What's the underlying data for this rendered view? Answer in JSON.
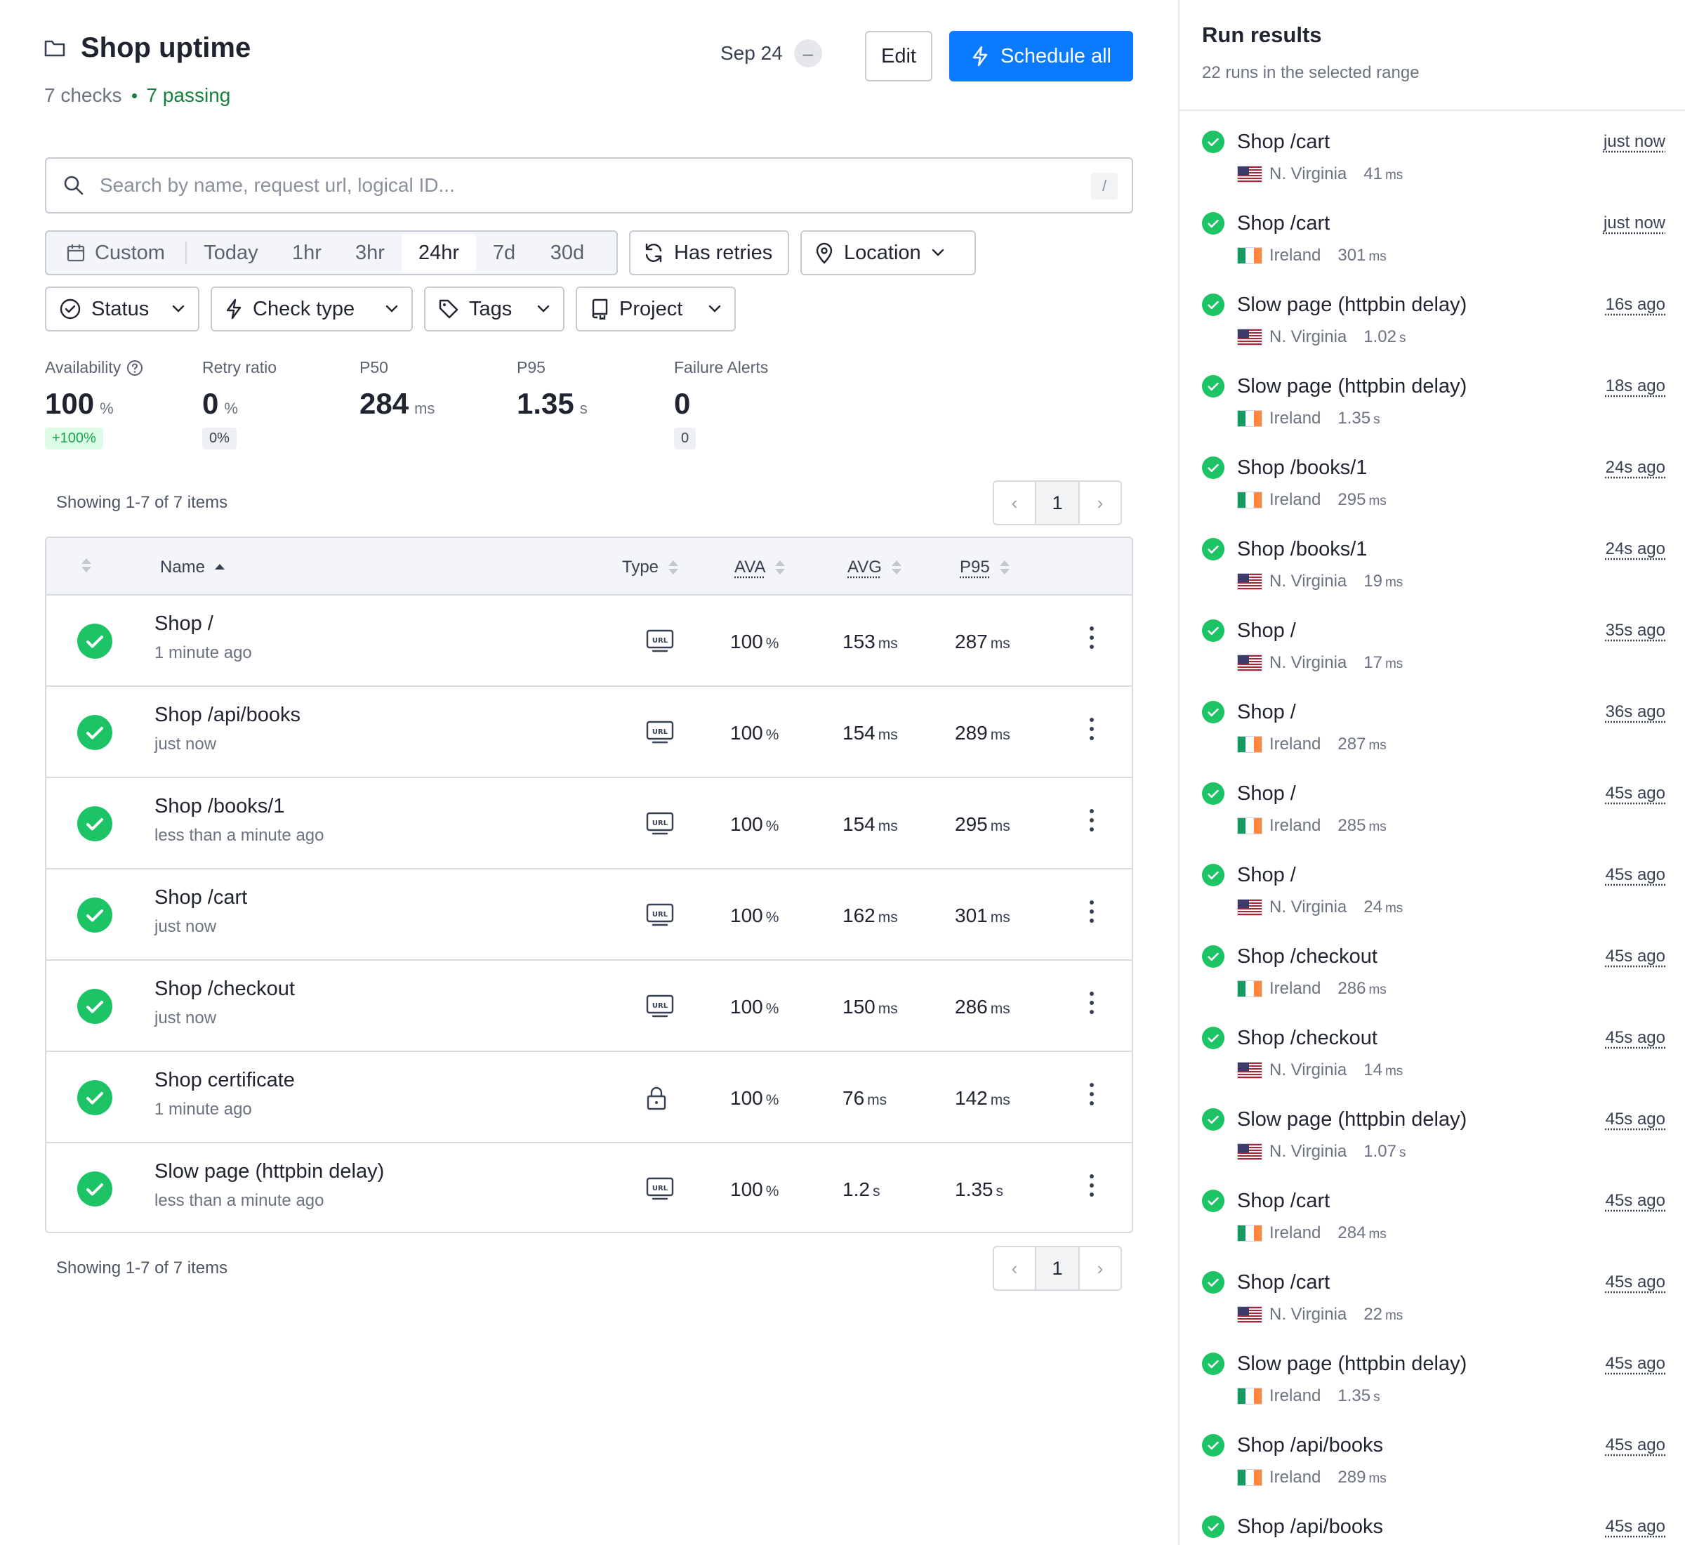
{
  "header": {
    "title": "Shop uptime",
    "checks_count": "7 checks",
    "passing": "7 passing",
    "date": "Sep 24",
    "date_clear": "–",
    "edit_label": "Edit",
    "schedule_label": "Schedule all"
  },
  "search": {
    "placeholder": "Search by name, request url, logical ID...",
    "shortcut": "/"
  },
  "filters": {
    "ranges": [
      "Custom",
      "Today",
      "1hr",
      "3hr",
      "24hr",
      "7d",
      "30d"
    ],
    "active_range": "24hr",
    "has_retries": "Has retries",
    "location": "Location",
    "status": "Status",
    "check_type": "Check type",
    "tags": "Tags",
    "project": "Project"
  },
  "stats": [
    {
      "label": "Availability",
      "value": "100",
      "unit": "%",
      "delta": "+100%"
    },
    {
      "label": "Retry ratio",
      "value": "0",
      "unit": "%",
      "delta": "0%"
    },
    {
      "label": "P50",
      "value": "284",
      "unit": "ms"
    },
    {
      "label": "P95",
      "value": "1.35",
      "unit": "s"
    },
    {
      "label": "Failure Alerts",
      "value": "0",
      "delta": "0"
    }
  ],
  "table": {
    "showing": "Showing 1-7 of 7 items",
    "page": "1",
    "columns": {
      "name": "Name",
      "type": "Type",
      "ava": "AVA",
      "avg": "AVG",
      "p95": "P95"
    },
    "rows": [
      {
        "name": "Shop /",
        "ago": "1 minute ago",
        "type": "url",
        "ava": "100",
        "ava_unit": "%",
        "avg": "153",
        "avg_unit": "ms",
        "p95": "287",
        "p95_unit": "ms"
      },
      {
        "name": "Shop /api/books",
        "ago": "just now",
        "type": "url",
        "ava": "100",
        "ava_unit": "%",
        "avg": "154",
        "avg_unit": "ms",
        "p95": "289",
        "p95_unit": "ms"
      },
      {
        "name": "Shop /books/1",
        "ago": "less than a minute ago",
        "type": "url",
        "ava": "100",
        "ava_unit": "%",
        "avg": "154",
        "avg_unit": "ms",
        "p95": "295",
        "p95_unit": "ms"
      },
      {
        "name": "Shop /cart",
        "ago": "just now",
        "type": "url",
        "ava": "100",
        "ava_unit": "%",
        "avg": "162",
        "avg_unit": "ms",
        "p95": "301",
        "p95_unit": "ms"
      },
      {
        "name": "Shop /checkout",
        "ago": "just now",
        "type": "url",
        "ava": "100",
        "ava_unit": "%",
        "avg": "150",
        "avg_unit": "ms",
        "p95": "286",
        "p95_unit": "ms"
      },
      {
        "name": "Shop certificate",
        "ago": "1 minute ago",
        "type": "lock",
        "ava": "100",
        "ava_unit": "%",
        "avg": "76",
        "avg_unit": "ms",
        "p95": "142",
        "p95_unit": "ms"
      },
      {
        "name": "Slow page (httpbin delay)",
        "ago": "less than a minute ago",
        "type": "url",
        "ava": "100",
        "ava_unit": "%",
        "avg": "1.2",
        "avg_unit": "s",
        "p95": "1.35",
        "p95_unit": "s"
      }
    ],
    "url_badge": "URL"
  },
  "panel": {
    "title": "Run results",
    "subtitle": "22 runs in the selected range",
    "runs": [
      {
        "name": "Shop /cart",
        "time": "just now",
        "location": "N. Virginia",
        "flag": "us",
        "duration": "41",
        "unit": "ms"
      },
      {
        "name": "Shop /cart",
        "time": "just now",
        "location": "Ireland",
        "flag": "ie",
        "duration": "301",
        "unit": "ms"
      },
      {
        "name": "Slow page (httpbin delay)",
        "time": "16s ago",
        "location": "N. Virginia",
        "flag": "us",
        "duration": "1.02",
        "unit": "s"
      },
      {
        "name": "Slow page (httpbin delay)",
        "time": "18s ago",
        "location": "Ireland",
        "flag": "ie",
        "duration": "1.35",
        "unit": "s"
      },
      {
        "name": "Shop /books/1",
        "time": "24s ago",
        "location": "Ireland",
        "flag": "ie",
        "duration": "295",
        "unit": "ms"
      },
      {
        "name": "Shop /books/1",
        "time": "24s ago",
        "location": "N. Virginia",
        "flag": "us",
        "duration": "19",
        "unit": "ms"
      },
      {
        "name": "Shop /",
        "time": "35s ago",
        "location": "N. Virginia",
        "flag": "us",
        "duration": "17",
        "unit": "ms"
      },
      {
        "name": "Shop /",
        "time": "36s ago",
        "location": "Ireland",
        "flag": "ie",
        "duration": "287",
        "unit": "ms"
      },
      {
        "name": "Shop /",
        "time": "45s ago",
        "location": "Ireland",
        "flag": "ie",
        "duration": "285",
        "unit": "ms"
      },
      {
        "name": "Shop /",
        "time": "45s ago",
        "location": "N. Virginia",
        "flag": "us",
        "duration": "24",
        "unit": "ms"
      },
      {
        "name": "Shop /checkout",
        "time": "45s ago",
        "location": "Ireland",
        "flag": "ie",
        "duration": "286",
        "unit": "ms"
      },
      {
        "name": "Shop /checkout",
        "time": "45s ago",
        "location": "N. Virginia",
        "flag": "us",
        "duration": "14",
        "unit": "ms"
      },
      {
        "name": "Slow page (httpbin delay)",
        "time": "45s ago",
        "location": "N. Virginia",
        "flag": "us",
        "duration": "1.07",
        "unit": "s"
      },
      {
        "name": "Shop /cart",
        "time": "45s ago",
        "location": "Ireland",
        "flag": "ie",
        "duration": "284",
        "unit": "ms"
      },
      {
        "name": "Shop /cart",
        "time": "45s ago",
        "location": "N. Virginia",
        "flag": "us",
        "duration": "22",
        "unit": "ms"
      },
      {
        "name": "Slow page (httpbin delay)",
        "time": "45s ago",
        "location": "Ireland",
        "flag": "ie",
        "duration": "1.35",
        "unit": "s"
      },
      {
        "name": "Shop /api/books",
        "time": "45s ago",
        "location": "Ireland",
        "flag": "ie",
        "duration": "289",
        "unit": "ms"
      },
      {
        "name": "Shop /api/books",
        "time": "45s ago"
      }
    ]
  },
  "colors": {
    "primary": "#0a7bff",
    "success": "#1dc466",
    "passing_text": "#15803d"
  }
}
